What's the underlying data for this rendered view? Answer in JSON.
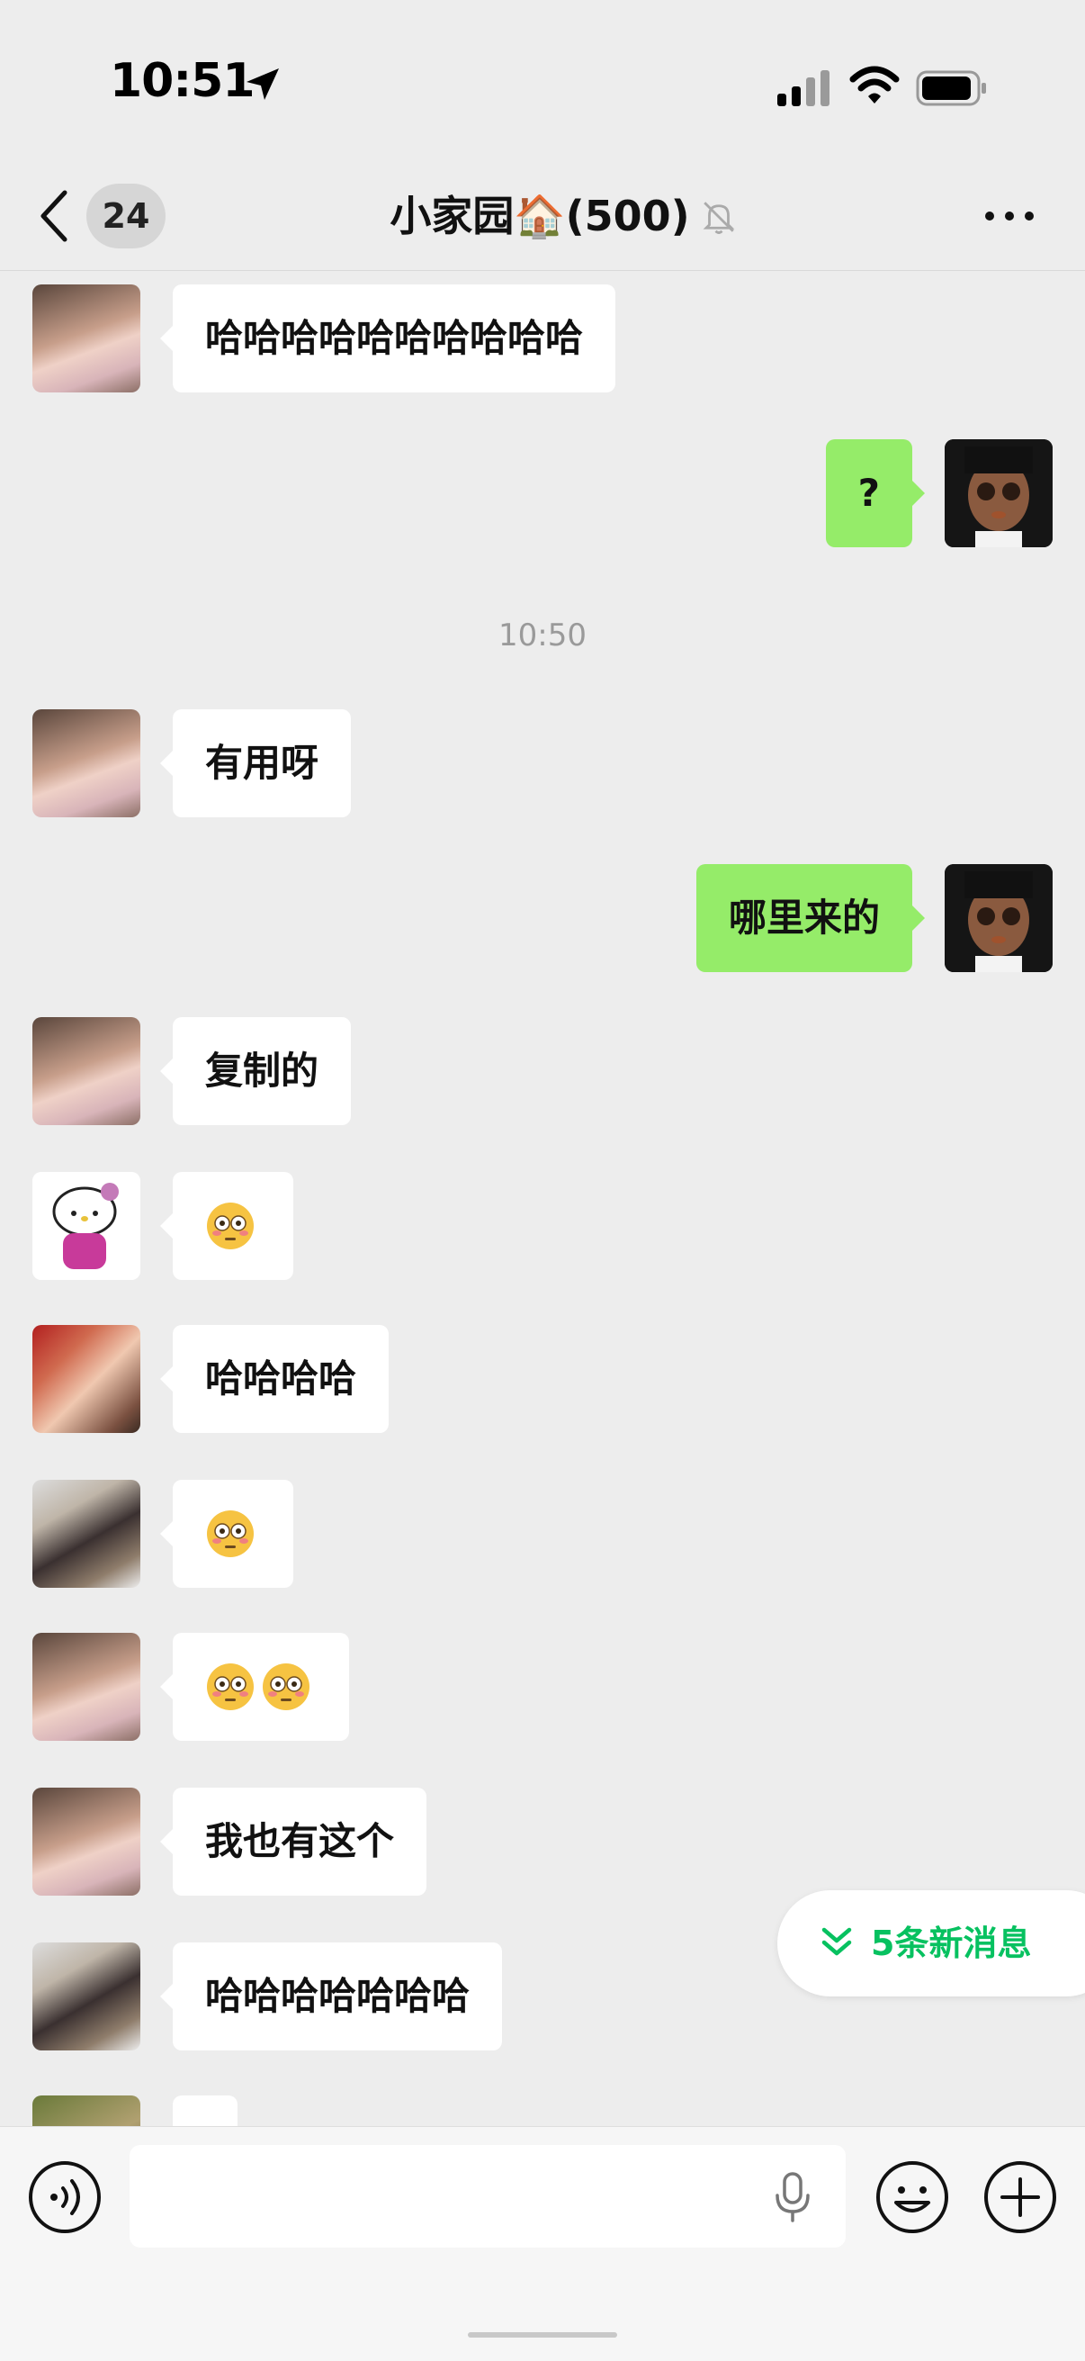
{
  "status_bar": {
    "time": "10:51"
  },
  "nav": {
    "unread_count": "24",
    "title": "小家园🏠(500)"
  },
  "messages": [
    {
      "side": "in",
      "text": "哈哈哈哈哈哈哈哈哈哈"
    },
    {
      "side": "out",
      "text": "?"
    },
    {
      "side": "in",
      "text": "有用呀"
    },
    {
      "side": "out",
      "text": "哪里来的"
    },
    {
      "side": "in",
      "text": "复制的"
    },
    {
      "side": "in",
      "emoji": "flushed-face"
    },
    {
      "side": "in",
      "text": "哈哈哈哈"
    },
    {
      "side": "in",
      "emoji": "flushed-face"
    },
    {
      "side": "in",
      "emoji": "flushed-face x2"
    },
    {
      "side": "in",
      "text": "我也有这个"
    },
    {
      "side": "in",
      "text": "哈哈哈哈哈哈哈"
    }
  ],
  "timestamp": "10:50",
  "new_messages": {
    "label": "5条新消息"
  },
  "colors": {
    "bg": "#ededed",
    "outgoing_bubble": "#95ec69",
    "accent": "#07c160"
  }
}
